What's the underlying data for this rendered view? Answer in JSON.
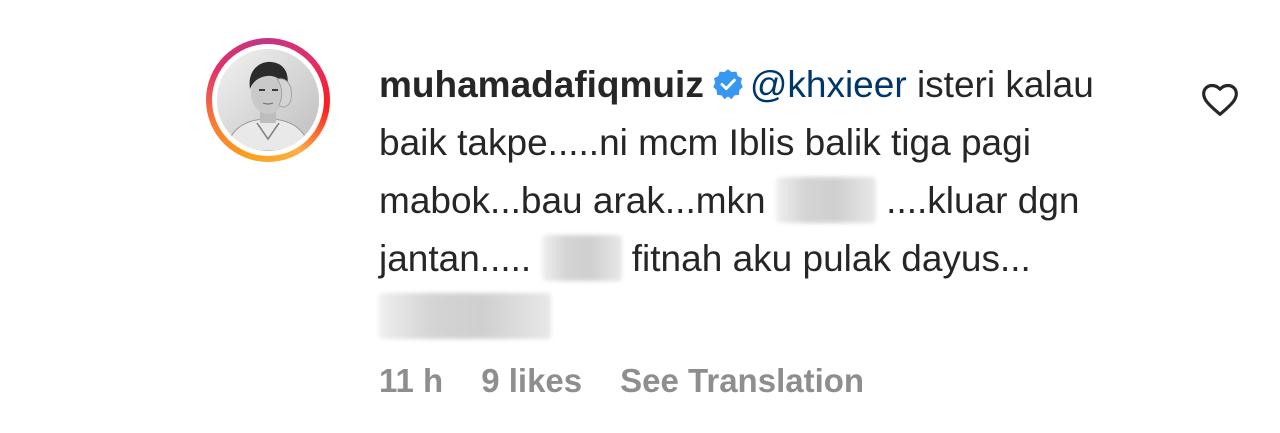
{
  "comment": {
    "username": "muhamadafiqmuiz",
    "mention": "@khxieer",
    "text_segments": [
      " isteri kalau baik takpe.....ni mcm Iblis balik tiga pagi mabok...bau arak...mkn ",
      " ....kluar dgn jantan..... ",
      " fitnah aku pulak dayus... "
    ]
  },
  "meta": {
    "time": "11 h",
    "likes": "9 likes",
    "translate": "See Translation"
  },
  "icons": {
    "verified": "verified-badge-icon",
    "like": "heart-icon"
  },
  "colors": {
    "verified": "#3897f0",
    "mention": "#00376b",
    "meta": "#8e8e8e",
    "text": "#262626"
  }
}
